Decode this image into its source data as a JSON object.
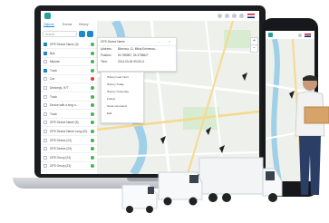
{
  "app": {
    "accent": "#1e88c8",
    "brand": "#27a09a"
  },
  "sidebar": {
    "tabs": [
      "Objects",
      "Events",
      "History"
    ],
    "search_placeholder": "Search",
    "items": [
      {
        "label": "GPS Device Name (3)",
        "checked": true,
        "status": "#4caf50"
      },
      {
        "label": "Bus",
        "checked": true,
        "status": "#4caf50"
      },
      {
        "label": "Minivan",
        "checked": false,
        "status": "#4caf50"
      },
      {
        "label": "Truck",
        "checked": true,
        "status": "#4caf50"
      },
      {
        "label": "Car",
        "checked": false,
        "status": "#e53935"
      },
      {
        "label": "Device(s), 977",
        "checked": false,
        "status": "#4caf50"
      },
      {
        "label": "Truck",
        "checked": false,
        "status": "#4caf50"
      },
      {
        "label": "Device with a long n...",
        "checked": false,
        "status": "#4caf50"
      },
      {
        "label": "Truck",
        "checked": false,
        "status": "#4caf50"
      },
      {
        "label": "GPS Device Name (5)",
        "checked": false,
        "status": "#4caf50"
      },
      {
        "label": "GPS Device Name Long (10)",
        "checked": false,
        "status": "#4caf50"
      },
      {
        "label": "GPS Device (24)",
        "checked": false,
        "status": "#4caf50"
      },
      {
        "label": "GPS Device (23)",
        "checked": false,
        "status": "#4caf50"
      },
      {
        "label": "GPS Group (24)",
        "checked": false,
        "status": "#4caf50"
      },
      {
        "label": "GPS Group (23)",
        "checked": false,
        "status": "#4caf50"
      }
    ]
  },
  "popup": {
    "title": "GPS Device Name",
    "address_label": "Address:",
    "address_value": "Bărnova, 11, Mihai Eminescu...",
    "position_label": "Position:",
    "position_value": "50.785987, 25.3758627",
    "time_label": "Time:",
    "time_value": "2014-03-06 09:03:11"
  },
  "context_menu": {
    "items": [
      "History Last Hour",
      "History Today",
      "History Yesterday",
      "Follow",
      "Send command",
      "Edit"
    ]
  }
}
